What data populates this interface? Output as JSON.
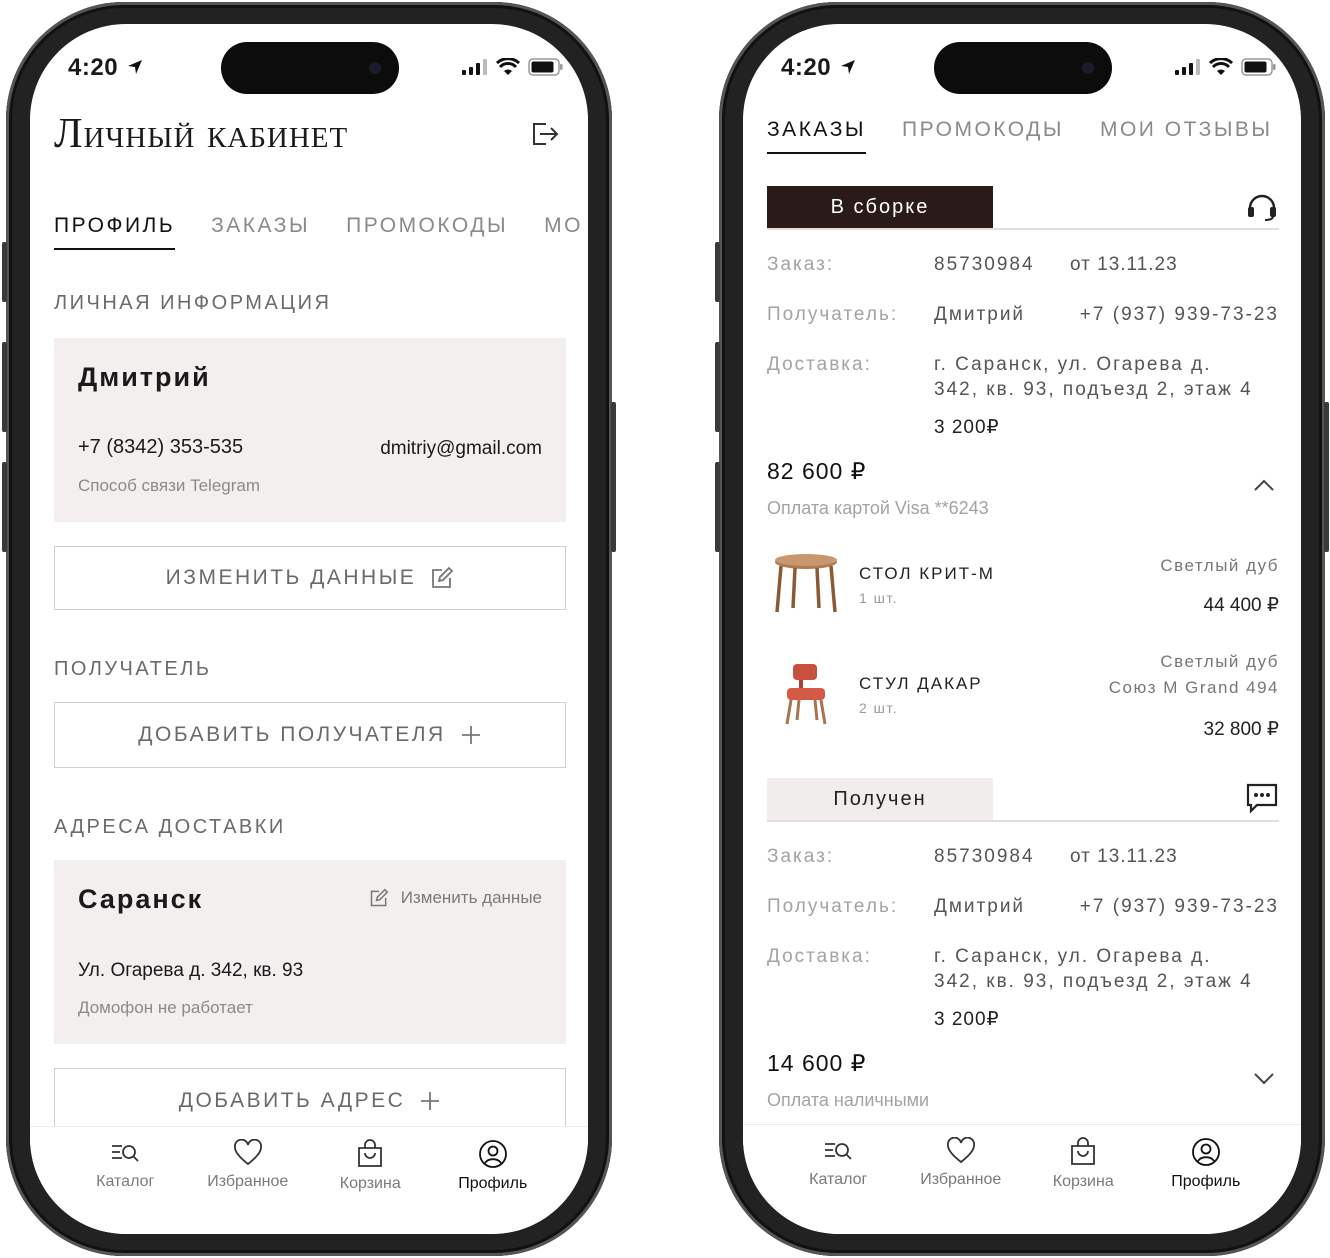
{
  "status_bar": {
    "time": "4:20"
  },
  "left": {
    "title": "Личный кабинет",
    "tabs": [
      "Профиль",
      "Заказы",
      "Промокоды",
      "Мо"
    ],
    "personal_section": "Личная информация",
    "person": {
      "name": "Дмитрий",
      "phone": "+7 (8342) 353-535",
      "email": "dmitriy@gmail.com",
      "contact_method": "Способ связи Telegram"
    },
    "edit_data_button": "Изменить данные",
    "recipient_section": "Получатель",
    "add_recipient_button": "Добавить получателя",
    "addresses_section": "Адреса доставки",
    "address": {
      "city": "Саранск",
      "edit_label": "Изменить данные",
      "street": "Ул. Огарева д. 342, кв. 93",
      "note": "Домофон не работает"
    },
    "add_address_button": "Добавить адрес"
  },
  "right": {
    "tabs": [
      "Заказы",
      "Промокоды",
      "Мои отзывы"
    ],
    "orders": [
      {
        "status": "В сборке",
        "order_label": "Заказ:",
        "order_number": "85730984",
        "order_date": "от 13.11.23",
        "recipient_label": "Получатель:",
        "recipient_name": "Дмитрий",
        "recipient_phone": "+7 (937) 939-73-23",
        "delivery_label": "Доставка:",
        "delivery_line1": "г. Саранск, ул. Огарева д.",
        "delivery_line2": "342, кв. 93, подъезд 2, этаж 4",
        "delivery_price": "3 200₽",
        "total": "82 600 ₽",
        "payment": "Оплата картой Visa **6243",
        "items": [
          {
            "name": "Стол Крит-М",
            "qty": "1 шт.",
            "option1": "Светлый дуб",
            "option2": "",
            "price": "44 400 ₽"
          },
          {
            "name": "Стул Дакар",
            "qty": "2 шт.",
            "option1": "Светлый дуб",
            "option2": "Союз М Grand 494",
            "price": "32 800 ₽"
          }
        ]
      },
      {
        "status": "Получен",
        "order_label": "Заказ:",
        "order_number": "85730984",
        "order_date": "от 13.11.23",
        "recipient_label": "Получатель:",
        "recipient_name": "Дмитрий",
        "recipient_phone": "+7 (937) 939-73-23",
        "delivery_label": "Доставка:",
        "delivery_line1": "г. Саранск, ул. Огарева д.",
        "delivery_line2": "342, кв. 93, подъезд 2, этаж 4",
        "delivery_price": "3 200₽",
        "total": "14 600 ₽",
        "payment": "Оплата наличными"
      }
    ]
  },
  "bottom_nav": [
    {
      "label": "Каталог",
      "icon": "catalog-search-icon"
    },
    {
      "label": "Избранное",
      "icon": "heart-icon"
    },
    {
      "label": "Корзина",
      "icon": "shopping-bag-icon"
    },
    {
      "label": "Профиль",
      "icon": "profile-icon",
      "active": true
    }
  ],
  "colors": {
    "card_bg": "#f3efee",
    "dark_badge": "#2a1a1a",
    "light_badge": "#f1edec",
    "chair_red": "#c8503e",
    "table_wood": "#a87450"
  }
}
